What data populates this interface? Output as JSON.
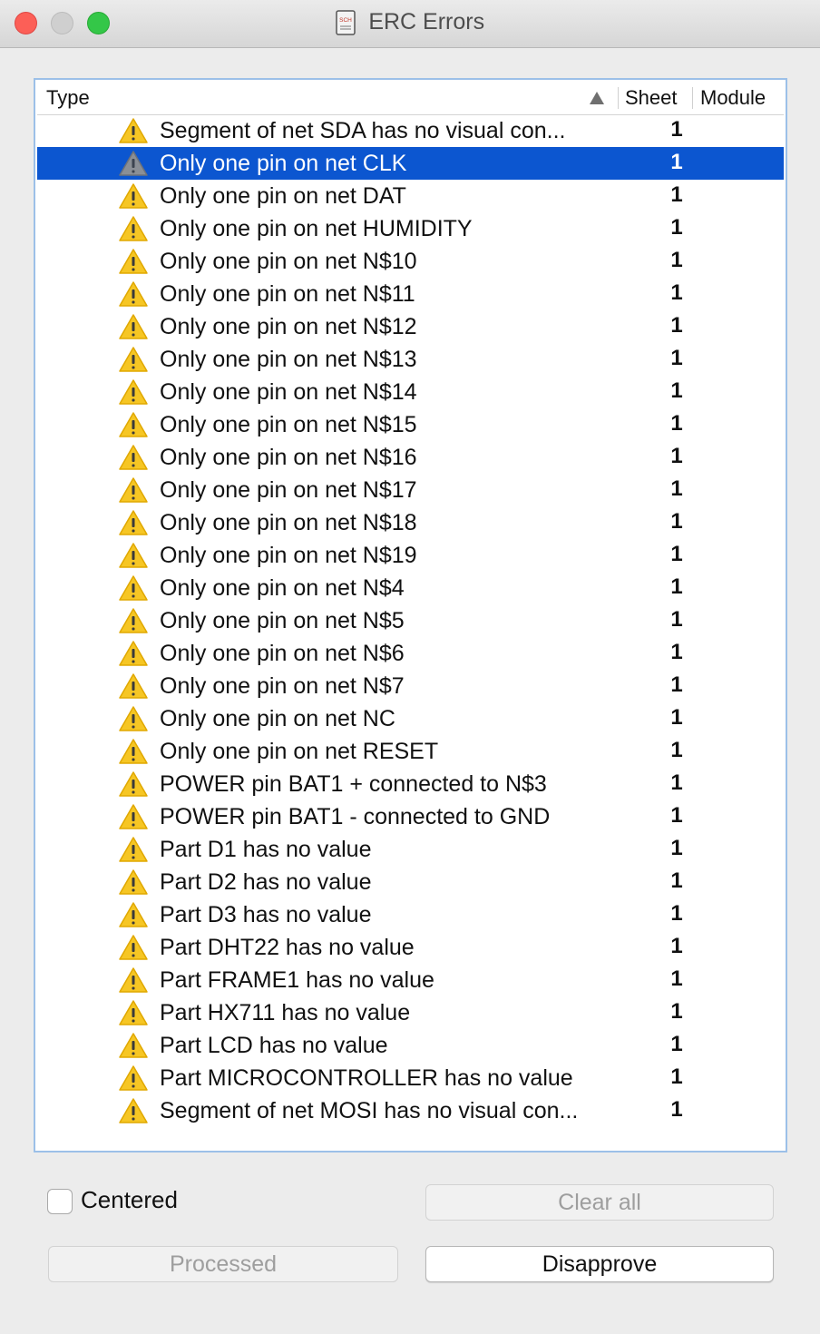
{
  "window": {
    "title": "ERC Errors",
    "title_icon": "sch-document-icon",
    "title_icon_text": "SCH"
  },
  "table": {
    "columns": [
      "Type",
      "Sheet",
      "Module"
    ],
    "sort_indicator": "ascending",
    "selected_index": 1,
    "rows": [
      {
        "type": "Segment of net SDA has no visual con...",
        "sheet": "1",
        "module": ""
      },
      {
        "type": "Only one pin on net CLK",
        "sheet": "1",
        "module": ""
      },
      {
        "type": "Only one pin on net DAT",
        "sheet": "1",
        "module": ""
      },
      {
        "type": "Only one pin on net HUMIDITY",
        "sheet": "1",
        "module": ""
      },
      {
        "type": "Only one pin on net N$10",
        "sheet": "1",
        "module": ""
      },
      {
        "type": "Only one pin on net N$11",
        "sheet": "1",
        "module": ""
      },
      {
        "type": "Only one pin on net N$12",
        "sheet": "1",
        "module": ""
      },
      {
        "type": "Only one pin on net N$13",
        "sheet": "1",
        "module": ""
      },
      {
        "type": "Only one pin on net N$14",
        "sheet": "1",
        "module": ""
      },
      {
        "type": "Only one pin on net N$15",
        "sheet": "1",
        "module": ""
      },
      {
        "type": "Only one pin on net N$16",
        "sheet": "1",
        "module": ""
      },
      {
        "type": "Only one pin on net N$17",
        "sheet": "1",
        "module": ""
      },
      {
        "type": "Only one pin on net N$18",
        "sheet": "1",
        "module": ""
      },
      {
        "type": "Only one pin on net N$19",
        "sheet": "1",
        "module": ""
      },
      {
        "type": "Only one pin on net N$4",
        "sheet": "1",
        "module": ""
      },
      {
        "type": "Only one pin on net N$5",
        "sheet": "1",
        "module": ""
      },
      {
        "type": "Only one pin on net N$6",
        "sheet": "1",
        "module": ""
      },
      {
        "type": "Only one pin on net N$7",
        "sheet": "1",
        "module": ""
      },
      {
        "type": "Only one pin on net NC",
        "sheet": "1",
        "module": ""
      },
      {
        "type": "Only one pin on net RESET",
        "sheet": "1",
        "module": ""
      },
      {
        "type": "POWER pin BAT1 + connected to N$3",
        "sheet": "1",
        "module": ""
      },
      {
        "type": "POWER pin BAT1 - connected to GND",
        "sheet": "1",
        "module": ""
      },
      {
        "type": "Part D1 has no value",
        "sheet": "1",
        "module": ""
      },
      {
        "type": "Part D2 has no value",
        "sheet": "1",
        "module": ""
      },
      {
        "type": "Part D3 has no value",
        "sheet": "1",
        "module": ""
      },
      {
        "type": "Part DHT22 has no value",
        "sheet": "1",
        "module": ""
      },
      {
        "type": "Part FRAME1 has no value",
        "sheet": "1",
        "module": ""
      },
      {
        "type": "Part HX711 has no value",
        "sheet": "1",
        "module": ""
      },
      {
        "type": "Part LCD has no value",
        "sheet": "1",
        "module": ""
      },
      {
        "type": "Part MICROCONTROLLER has no value",
        "sheet": "1",
        "module": ""
      },
      {
        "type": "Segment of net MOSI has no visual con...",
        "sheet": "1",
        "module": ""
      }
    ]
  },
  "controls": {
    "centered_label": "Centered",
    "centered_checked": false,
    "clear_all_label": "Clear all",
    "processed_label": "Processed",
    "disapprove_label": "Disapprove"
  },
  "colors": {
    "selection": "#0c56d0",
    "warning_fill": "#f6c624",
    "frame_focus": "#9cc0e8"
  }
}
